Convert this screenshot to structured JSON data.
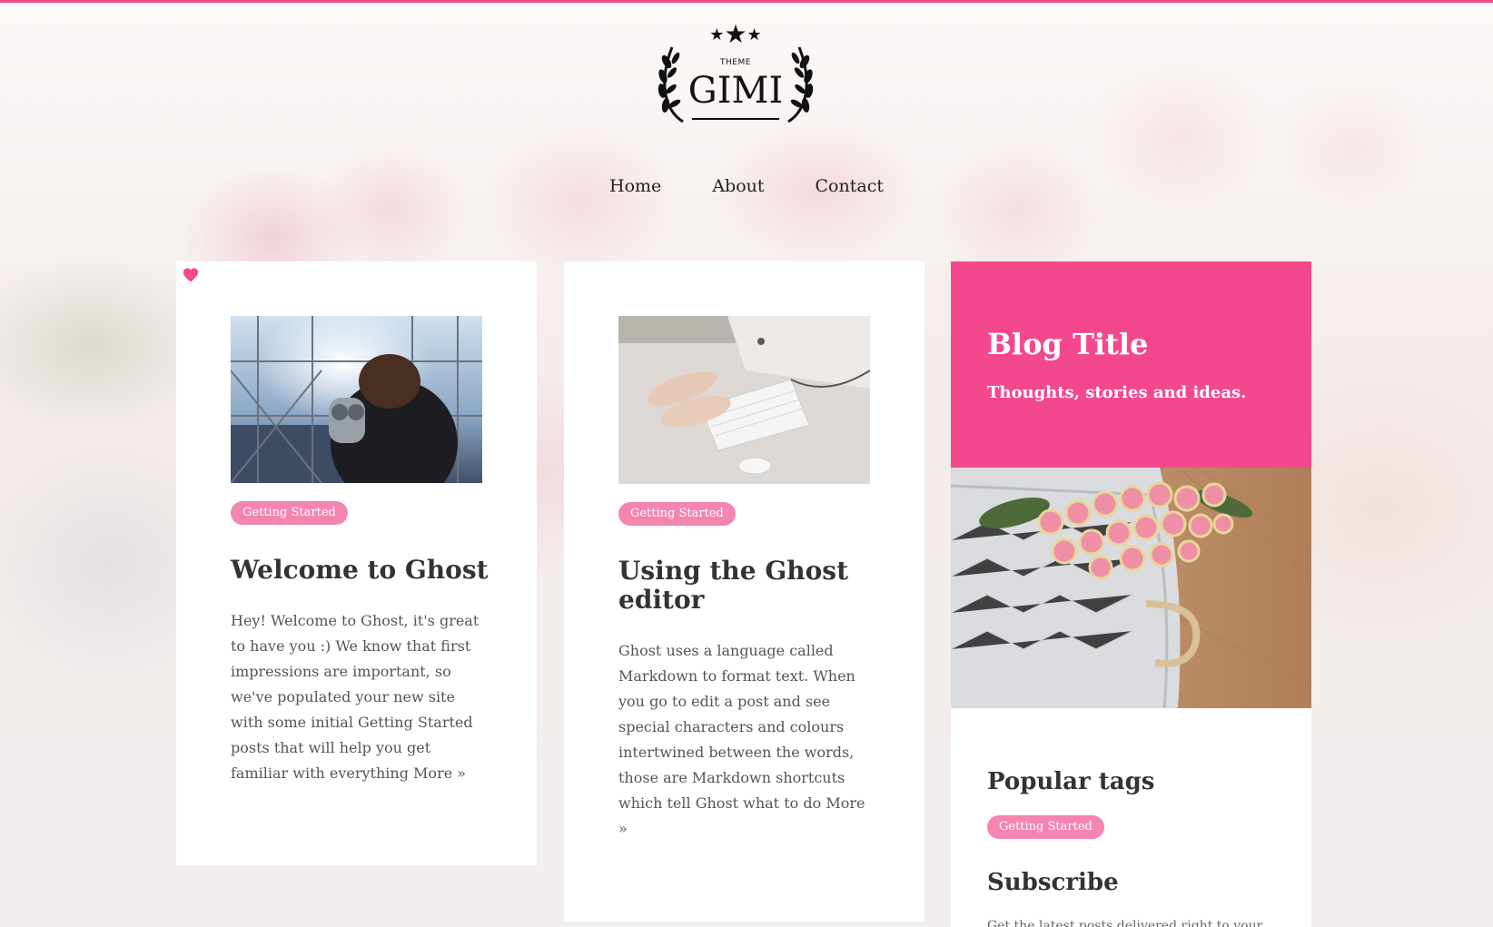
{
  "theme": {
    "accent": "#f3478e",
    "tag_bg": "#f484b2"
  },
  "logo": {
    "small_text": "THEME",
    "name": "GIMI"
  },
  "nav": {
    "items": [
      "Home",
      "About",
      "Contact"
    ]
  },
  "posts": [
    {
      "tag": "Getting Started",
      "title": "Welcome to Ghost",
      "excerpt": "Hey! Welcome to Ghost, it's great to have you :) We know that first impressions are important, so we've populated your new site with some initial Getting Started posts that will help you get familiar with everything",
      "more": "More »"
    },
    {
      "tag": "Getting Started",
      "title": "Using the Ghost editor",
      "excerpt": "Ghost uses a language called Markdown to format text. When you go to edit a post and see special characters and colours intertwined between the words, those are Markdown shortcuts which tell Ghost what to do",
      "more": "More »"
    }
  ],
  "sidebar": {
    "blog_title": "Blog Title",
    "blog_description": "Thoughts, stories and ideas.",
    "popular_tags_heading": "Popular tags",
    "popular_tags": [
      "Getting Started"
    ],
    "subscribe_heading": "Subscribe",
    "subscribe_text": "Get the latest posts delivered right to your"
  }
}
